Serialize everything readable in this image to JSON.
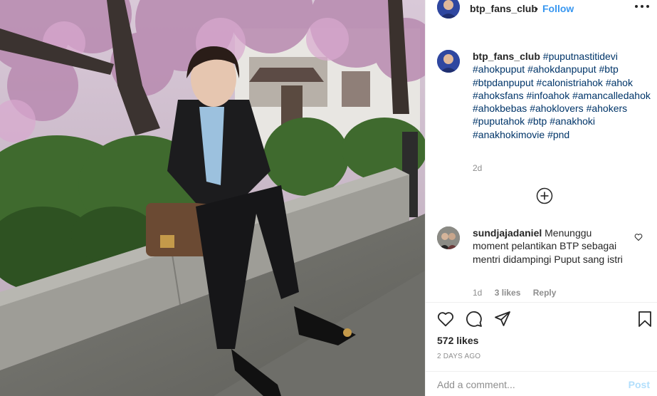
{
  "post": {
    "username": "btp_fans_club",
    "separator": "•",
    "follow_label": "Follow",
    "caption": {
      "username": "btp_fans_club",
      "hashtags": [
        "#puputnastitidevi",
        "#ahokpuput",
        "#ahokdanpuput",
        "#btp",
        "#btpdanpuput",
        "#calonistriahok",
        "#ahok",
        "#ahoksfans",
        "#infoahok",
        "#amancalledahok",
        "#ahokbebas",
        "#ahoklovers",
        "#ahokers",
        "#puputahok",
        "#btp",
        "#anakhoki",
        "#anakhokimovie",
        "#pnd"
      ],
      "time": "2d"
    },
    "comment": {
      "username": "sundjajadaniel",
      "text": "Menunggu moment pelantikan BTP sebagai mentri didampingi Puput sang istri",
      "time": "1d",
      "likes": "3 likes",
      "reply": "Reply"
    },
    "likes_count": "572 likes",
    "date": "2 DAYS AGO",
    "add_comment_placeholder": "Add a comment...",
    "post_button": "Post"
  },
  "icons": {
    "more": "more-horizontal-icon",
    "load_more": "plus-circle-icon",
    "like": "heart-outline-icon",
    "comment": "speech-bubble-icon",
    "share": "paper-plane-icon",
    "save": "bookmark-icon",
    "comment_like": "small-heart-icon"
  },
  "colors": {
    "link_blue": "#3897f0",
    "hashtag": "#003569",
    "muted": "#8e8e8e",
    "post_disabled": "#b2dffc"
  }
}
